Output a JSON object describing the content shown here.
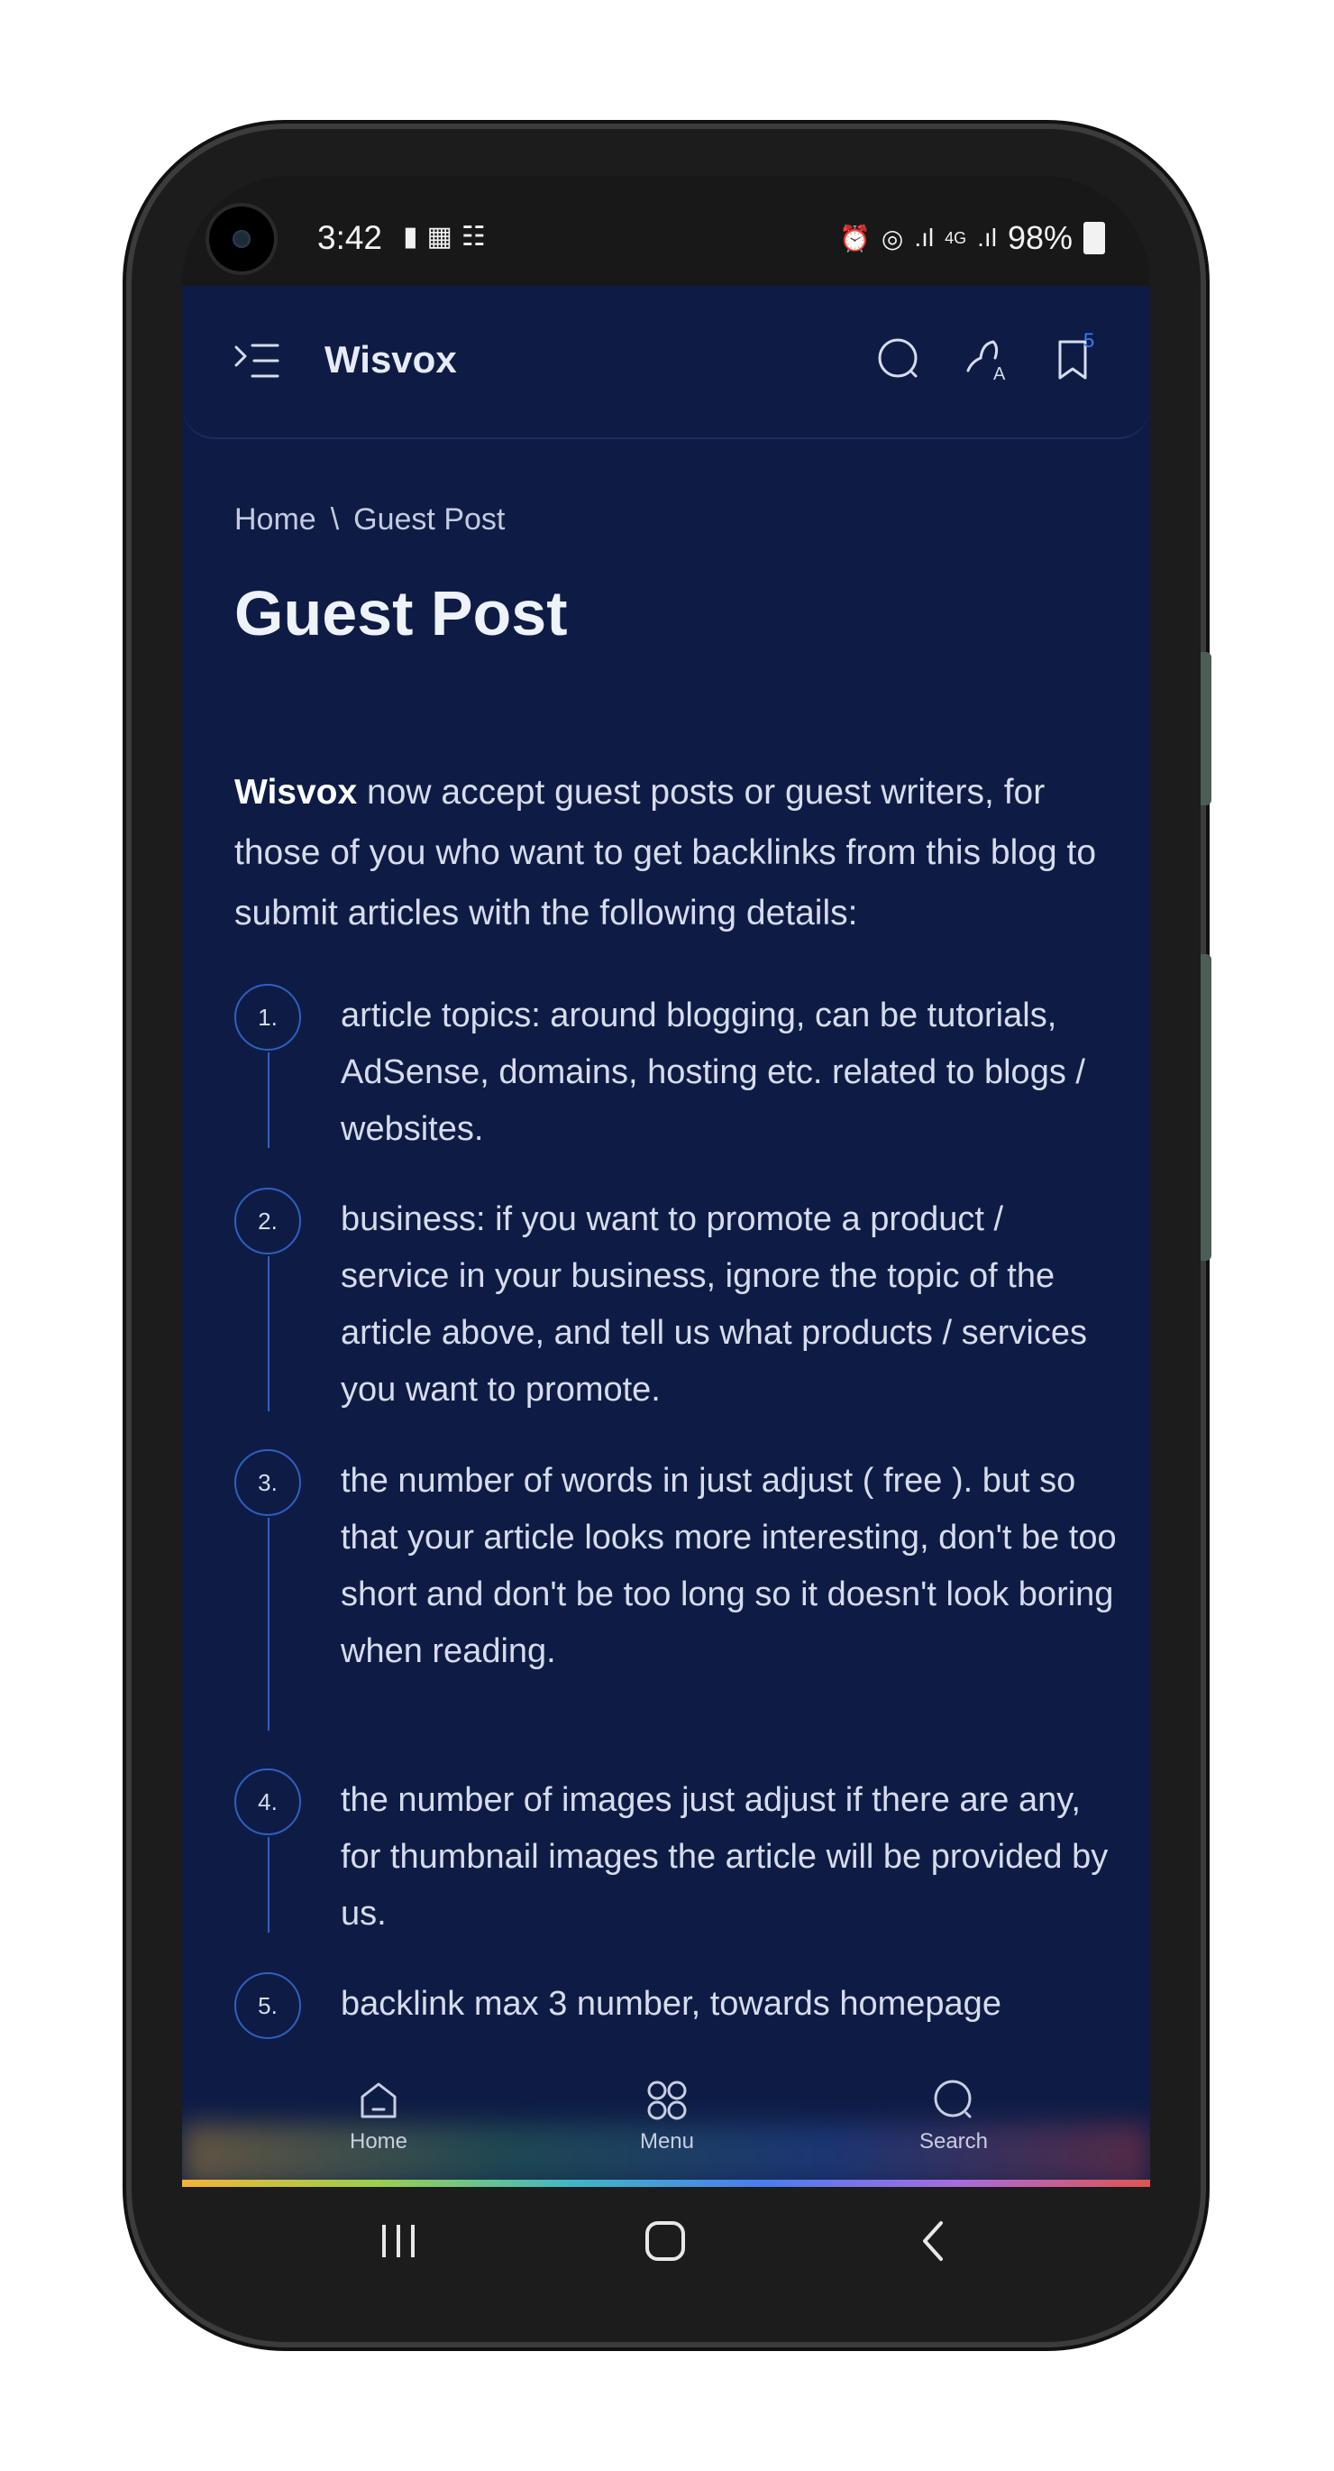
{
  "status_bar": {
    "time": "3:42",
    "left_icons": [
      "message-icon",
      "image-icon",
      "notification-icon"
    ],
    "right_signal": ".ıl",
    "network": "4G",
    "battery": "98%"
  },
  "header": {
    "site_title": "Wisvox",
    "bookmark_count": "5"
  },
  "breadcrumb": {
    "home": "Home",
    "separator": "\\",
    "current": "Guest Post"
  },
  "page": {
    "title": "Guest Post",
    "intro_bold": "Wisvox",
    "intro_rest": " now accept guest posts or guest writers, for those of you who want to get backlinks from this blog to submit articles with the following details:",
    "items": [
      {
        "num": "1.",
        "text": "article topics: around blogging, can be tutorials, AdSense, domains, hosting etc. related to blogs / websites."
      },
      {
        "num": "2.",
        "text": "business: if you want to promote a product / service in your business, ignore the topic of the article above, and tell us what products / services you want to promote."
      },
      {
        "num": "3.",
        "text": "the number of words in just adjust ( free ). but so that your article looks more interesting, don't be too short and don't be too long so it doesn't look boring when reading."
      },
      {
        "num": "4.",
        "text": "the number of images just adjust if there are any, for thumbnail images the article will be provided by us."
      },
      {
        "num": "5.",
        "text": "backlink max 3 number, towards homepage"
      }
    ]
  },
  "bottom_nav": {
    "home": "Home",
    "menu": "Menu",
    "search": "Search"
  },
  "colors": {
    "background": "#0e1c45",
    "accent": "#2f5fc0",
    "text": "#d7dcec"
  }
}
